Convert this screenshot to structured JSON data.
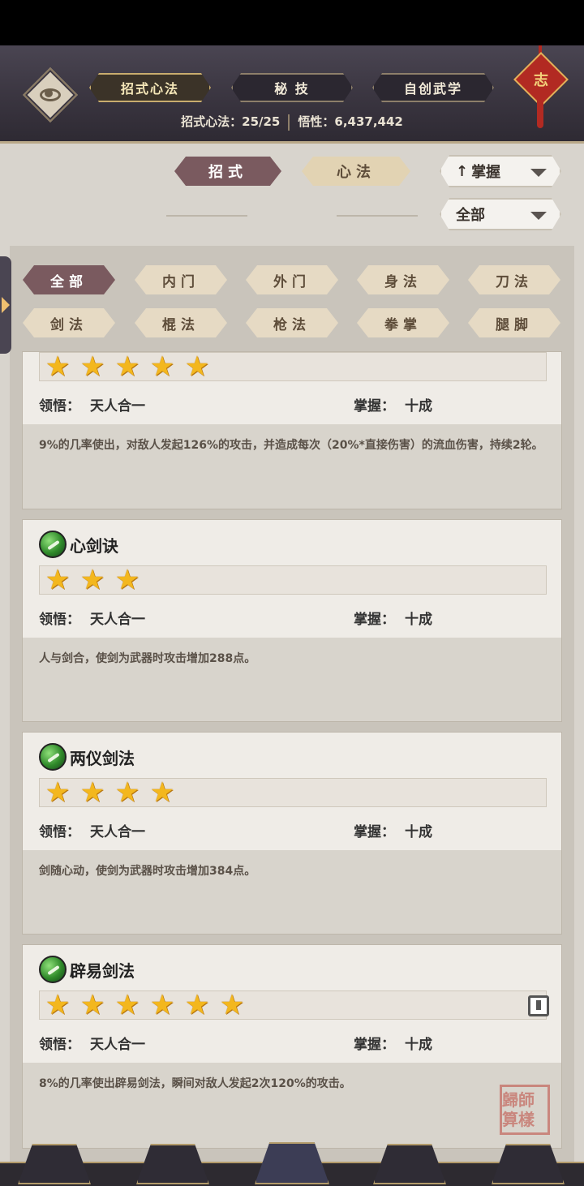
{
  "header": {
    "tabs": [
      {
        "label": "招式心法",
        "active": true
      },
      {
        "label": "秘 技",
        "active": false
      },
      {
        "label": "自创武学",
        "active": false
      }
    ],
    "stats": {
      "label1": "招式心法：",
      "value1": "25/25",
      "label2": "悟性：",
      "value2": "6,437,442"
    },
    "knot_char": "志"
  },
  "subtabs": [
    {
      "label": "招式",
      "active": true
    },
    {
      "label": "心法",
      "active": false
    }
  ],
  "sort_dropdown": {
    "label": "掌握",
    "arrow": "↑"
  },
  "scope_dropdown": {
    "label": "全部"
  },
  "filters": [
    {
      "label": "全部",
      "active": true
    },
    {
      "label": "内门",
      "active": false
    },
    {
      "label": "外门",
      "active": false
    },
    {
      "label": "身法",
      "active": false
    },
    {
      "label": "刀法",
      "active": false
    },
    {
      "label": "剑法",
      "active": false
    },
    {
      "label": "棍法",
      "active": false
    },
    {
      "label": "枪法",
      "active": false
    },
    {
      "label": "拳掌",
      "active": false
    },
    {
      "label": "腿脚",
      "active": false
    }
  ],
  "skills": [
    {
      "name": "",
      "stars": 5,
      "comprehension_label": "领悟：",
      "comprehension": "天人合一",
      "mastery_label": "掌握：",
      "mastery": "十成",
      "description": "9%的几率使出，对敌人发起126%的攻击，并造成每次（20%*直接伤害）的流血伤害，持续2轮。"
    },
    {
      "name": "心剑诀",
      "stars": 3,
      "comprehension_label": "领悟：",
      "comprehension": "天人合一",
      "mastery_label": "掌握：",
      "mastery": "十成",
      "description": "人与剑合，使剑为武器时攻击增加288点。"
    },
    {
      "name": "两仪剑法",
      "stars": 4,
      "comprehension_label": "领悟：",
      "comprehension": "天人合一",
      "mastery_label": "掌握：",
      "mastery": "十成",
      "description": "剑随心动，使剑为武器时攻击增加384点。"
    },
    {
      "name": "辟易剑法",
      "stars": 6,
      "comprehension_label": "领悟：",
      "comprehension": "天人合一",
      "mastery_label": "掌握：",
      "mastery": "十成",
      "description": "8%的几率使出辟易剑法，瞬间对敌人发起2次120%的攻击。"
    }
  ],
  "seal_text": "歸師算樣",
  "colors": {
    "accent_dark": "#7a5a5f",
    "accent_light": "#e2d3b3",
    "star": "#f3b71e",
    "header_bg": "#3a3540"
  }
}
